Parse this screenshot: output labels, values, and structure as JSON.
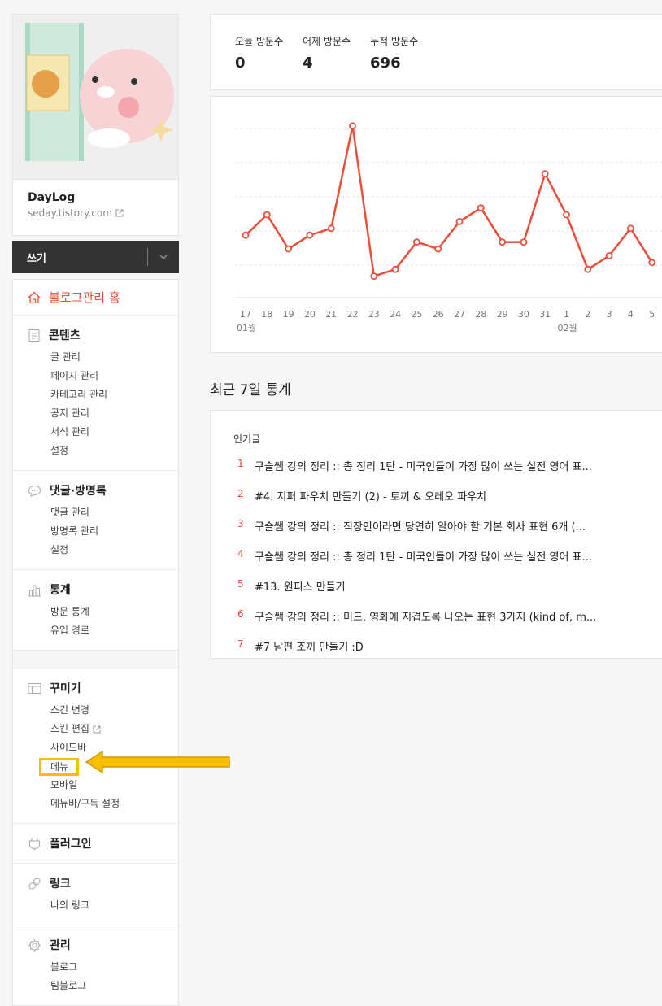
{
  "profile": {
    "blog_name": "DayLog",
    "blog_url": "seday.tistory.com"
  },
  "write": {
    "label": "쓰기"
  },
  "menu": {
    "home": "블로그관리 홈",
    "contents": {
      "title": "콘텐츠",
      "items": [
        "글 관리",
        "페이지 관리",
        "카테고리 관리",
        "공지 관리",
        "서식 관리",
        "설정"
      ]
    },
    "comments": {
      "title": "댓글·방명록",
      "items": [
        "댓글 관리",
        "방명록 관리",
        "설정"
      ]
    },
    "stats": {
      "title": "통계",
      "items": [
        "방문 통계",
        "유입 경로"
      ]
    },
    "design": {
      "title": "꾸미기",
      "items": [
        "스킨 변경",
        "스킨 편집",
        "사이드바",
        "메뉴",
        "모바일",
        "메뉴바/구독 설정"
      ]
    },
    "plugin": {
      "title": "플러그인"
    },
    "link": {
      "title": "링크",
      "items": [
        "나의 링크"
      ]
    },
    "admin": {
      "title": "관리",
      "items": [
        "블로그",
        "팀블로그"
      ]
    }
  },
  "visitors": {
    "today_label": "오늘 방문수",
    "today": "0",
    "yesterday_label": "어제 방문수",
    "yesterday": "4",
    "total_label": "누적 방문수",
    "total": "696"
  },
  "chart_data": {
    "type": "line",
    "x": [
      "17",
      "18",
      "19",
      "20",
      "21",
      "22",
      "23",
      "24",
      "25",
      "26",
      "27",
      "28",
      "29",
      "30",
      "31",
      "1",
      "2",
      "3",
      "4",
      "5"
    ],
    "month_labels": [
      "01월",
      "02월"
    ],
    "values": [
      7,
      10,
      5,
      7,
      8,
      23,
      1,
      2,
      6,
      5,
      9,
      11,
      6,
      6,
      16,
      10,
      2,
      4,
      8,
      3
    ],
    "ylim": [
      0,
      25
    ],
    "grid": true,
    "color": "#f04c3b"
  },
  "recent": {
    "title": "최근 7일 통계",
    "popular_label": "인기글",
    "posts": [
      {
        "rank": "1",
        "title": "구슬쌤 강의 정리 :: 총 정리 1탄 - 미국인들이 가장 많이 쓰는 실전 영어 표..."
      },
      {
        "rank": "2",
        "title": "#4. 지퍼 파우치 만들기 (2) - 토끼 & 오레오 파우치"
      },
      {
        "rank": "3",
        "title": "구슬쌤 강의 정리 :: 직장인이라면 당연히 알아야 할 기본 회사 표현 6개 (..."
      },
      {
        "rank": "4",
        "title": "구슬쌤 강의 정리 :: 총 정리 1탄 - 미국인들이 가장 많이 쓰는 실전 영어 표..."
      },
      {
        "rank": "5",
        "title": "#13. 원피스 만들기"
      },
      {
        "rank": "6",
        "title": "구슬쌤 강의 정리 :: 미드, 영화에 지겹도록 나오는 표현 3가지 (kind of, m..."
      },
      {
        "rank": "7",
        "title": "#7 남편 조끼 만들기 :D"
      }
    ]
  }
}
